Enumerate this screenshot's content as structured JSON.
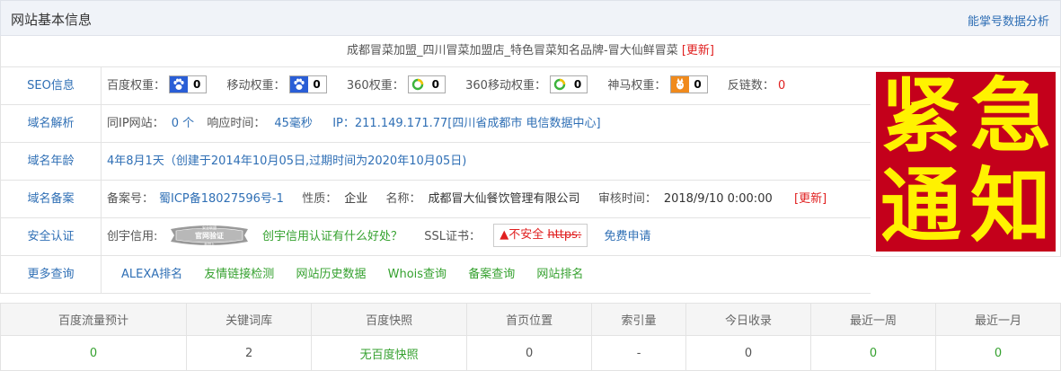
{
  "header": {
    "title": "网站基本信息",
    "link": "能掌号数据分析"
  },
  "site_title": {
    "text": "成都冒菜加盟_四川冒菜加盟店_特色冒菜知名品牌-冒大仙鲜冒菜",
    "update": "[更新]"
  },
  "seo": {
    "label": "SEO信息",
    "items": [
      {
        "name": "百度权重：",
        "icon": "baidu-paw-icon",
        "value": "0"
      },
      {
        "name": "移动权重：",
        "icon": "baidu-paw-icon",
        "value": "0"
      },
      {
        "name": "360权重：",
        "icon": "360-icon",
        "value": "0"
      },
      {
        "name": "360移动权重：",
        "icon": "360-icon",
        "value": "0"
      },
      {
        "name": "神马权重：",
        "icon": "shenma-icon",
        "value": "0"
      }
    ],
    "backlinks_label": "反链数：",
    "backlinks_value": "0"
  },
  "dns": {
    "label": "域名解析",
    "same_ip_label": "同IP网站：",
    "same_ip_value": "0 个",
    "response_label": "响应时间：",
    "response_value": "45毫秒",
    "ip_text": "IP：211.149.171.77[四川省成都市 电信数据中心]"
  },
  "age": {
    "label": "域名年龄",
    "text": "4年8月1天（创建于2014年10月05日,过期时间为2020年10月05日)"
  },
  "icp": {
    "label": "域名备案",
    "num_label": "备案号：",
    "num_value": "蜀ICP备18027596号-1",
    "nature_label": "性质：",
    "nature_value": "企业",
    "name_label": "名称：",
    "name_value": "成都冒大仙餐饮管理有限公司",
    "review_label": "审核时间：",
    "review_value": "2018/9/10 0:00:00",
    "update": "[更新]"
  },
  "security": {
    "label": "安全认证",
    "credit_label": "创宇信用:",
    "seal_text": "官网验证",
    "seal_top": "安全联盟",
    "seal_bottom": "未加入",
    "credit_link": "创宇信用认证有什么好处？",
    "ssl_label": "SSL证书：",
    "ssl_warn": "▲不安全",
    "ssl_https": "https:",
    "ssl_apply": "免费申请"
  },
  "more": {
    "label": "更多查询",
    "links": [
      "ALEXA排名",
      "友情链接检测",
      "网站历史数据",
      "Whois查询",
      "备案查询",
      "网站排名"
    ]
  },
  "notice": {
    "chars": [
      "紧",
      "急",
      "通",
      "知"
    ]
  },
  "stats": {
    "headers": [
      "百度流量预计",
      "关键词库",
      "百度快照",
      "首页位置",
      "索引量",
      "今日收录",
      "最近一周",
      "最近一月"
    ],
    "values": [
      "0",
      "2",
      "无百度快照",
      "0",
      "-",
      "0",
      "0",
      "0"
    ]
  },
  "colors": {
    "link": "#2f6fb5",
    "green": "#35a12f",
    "red": "#e02020",
    "notice_bg": "#c4001b",
    "notice_text": "#fff200"
  }
}
